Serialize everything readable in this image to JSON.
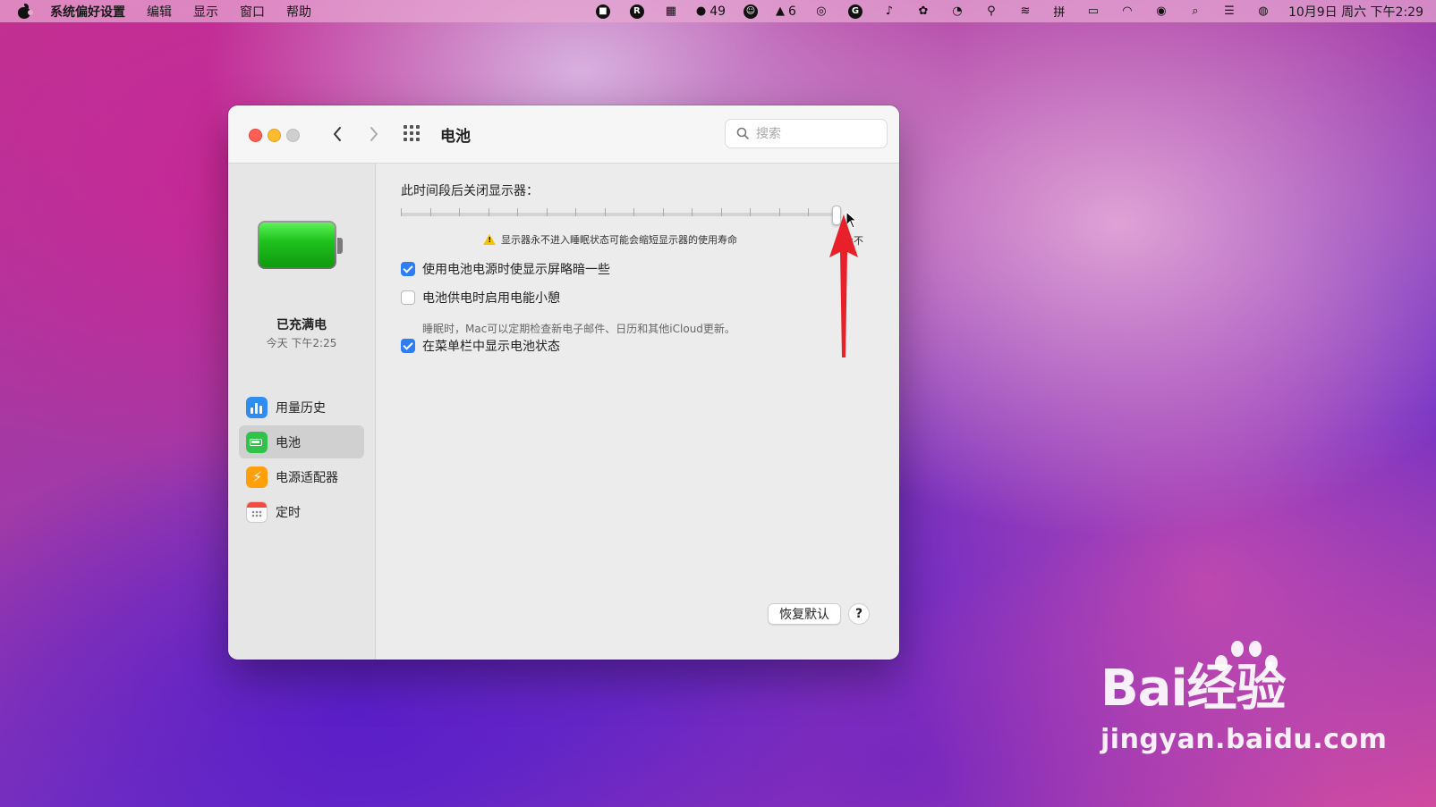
{
  "menubar": {
    "app_name": "系统偏好设置",
    "items": [
      "编辑",
      "显示",
      "窗口",
      "帮助"
    ],
    "wechat_count": "49",
    "qq_count": "6",
    "clock": "10月9日 周六 下午2:29"
  },
  "window": {
    "title": "电池",
    "search_placeholder": "搜索"
  },
  "sidebar": {
    "charge_status": "已充满电",
    "charge_time": "今天 下午2:25",
    "items": [
      {
        "label": "用量历史",
        "icon": "chart-icon"
      },
      {
        "label": "电池",
        "icon": "battery-icon",
        "selected": true
      },
      {
        "label": "电源适配器",
        "icon": "power-adapter-icon"
      },
      {
        "label": "定时",
        "icon": "calendar-icon"
      }
    ]
  },
  "content": {
    "slider_label": "此时间段后关闭显示器：",
    "slider_value": "永不",
    "slider_level": 1.0,
    "warning": "显示器永不进入睡眠状态可能会缩短显示器的使用寿命",
    "options": [
      {
        "label": "使用电池电源时使显示屏略暗一些",
        "checked": true
      },
      {
        "label": "电池供电时启用电能小憩",
        "checked": false
      },
      {
        "label": "在菜单栏中显示电池状态",
        "checked": true
      }
    ],
    "power_nap_desc": "睡眠时，Mac可以定期检查新电子邮件、日历和其他iCloud更新。",
    "restore_button": "恢复默认",
    "help_button": "?"
  },
  "watermark": {
    "brand": "Bai经验",
    "url": "jingyan.baidu.com"
  },
  "colors": {
    "accent": "#2e7cf6",
    "close": "#ff5f57",
    "minimize": "#febc2e",
    "battery_fill": "#20c41f",
    "annotation_arrow": "#e8202a"
  }
}
